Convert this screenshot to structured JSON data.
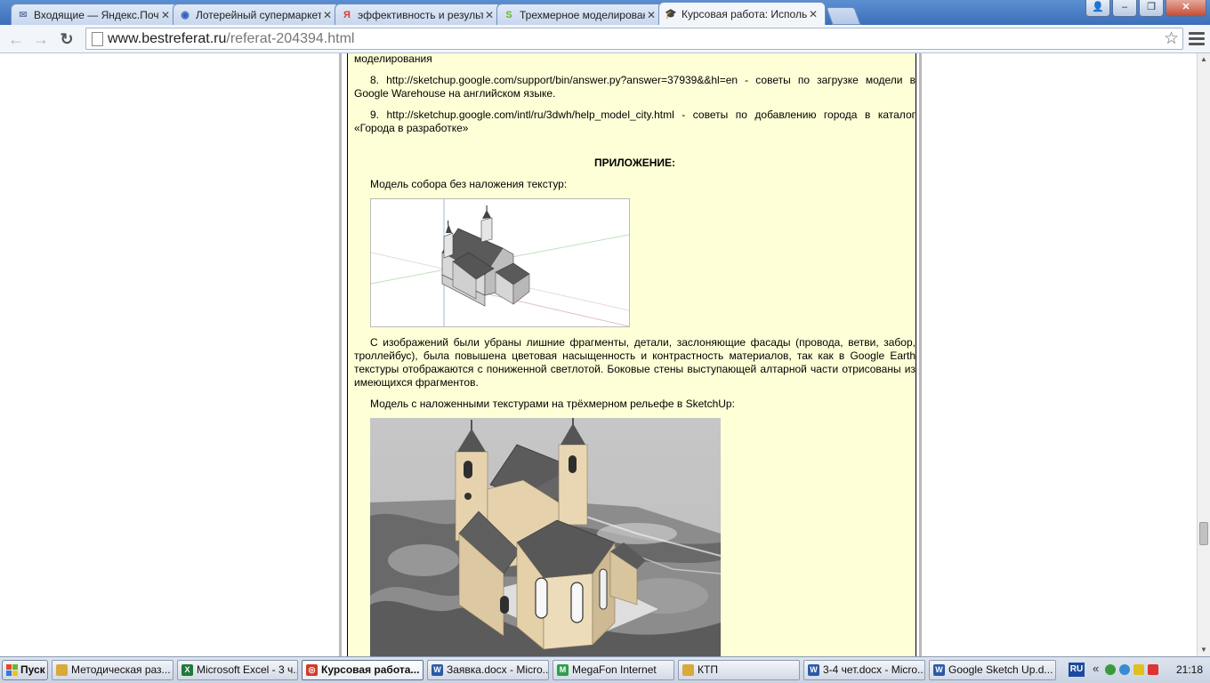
{
  "browser": {
    "tabs": [
      {
        "title": "Входящие — Яндекс.Почта",
        "icon": "mail-icon",
        "color": "#6a7da8",
        "glyph": "✉",
        "active": false
      },
      {
        "title": "Лотерейный супермаркет Столото",
        "icon": "globe-icon",
        "color": "#2e63b8",
        "glyph": "◉",
        "active": false
      },
      {
        "title": "эффективность и результаты",
        "icon": "yandex-icon",
        "color": "#e13a2e",
        "glyph": "Я",
        "active": false
      },
      {
        "title": "Трехмерное моделирование",
        "icon": "site-icon",
        "color": "#6ab52e",
        "glyph": "S",
        "active": false
      },
      {
        "title": "Курсовая работа: Использование",
        "icon": "graduation-cap-icon",
        "color": "#333333",
        "glyph": "🎓",
        "active": true
      }
    ],
    "url_domain": "www.bestreferat.ru",
    "url_path": "/referat-204394.html",
    "window_buttons": {
      "user": "👤",
      "minimize": "–",
      "maximize": "❐",
      "close": "✕"
    },
    "nav": {
      "back": "←",
      "forward": "→",
      "reload": "↻",
      "star": "☆"
    }
  },
  "article": {
    "line_top": "моделирования",
    "ref8": "8. http://sketchup.google.com/support/bin/answer.py?answer=37939&&hl=en - советы по загрузке модели в Google Warehouse на английском языке.",
    "ref9": "9. http://sketchup.google.com/intl/ru/3dwh/help_model_city.html - советы по добавлению города в каталог «Города в разработке»",
    "appendix_heading": "ПРИЛОЖЕНИЕ:",
    "caption1": "Модель собора без наложения текстур:",
    "paragraph": "С изображений были убраны лишние фрагменты, детали, заслоняющие фасады (провода, ветви, забор, троллейбус), была повышена цветовая насыщенность и контрастность материалов, так как в Google Earth текстуры отображаются с пониженной светлотой. Боковые стены выступающей алтарной части отрисованы из имеющихся фрагментов.",
    "caption2": "Модель с наложенными текстурами на трёхмерном рельефе в SketchUp:"
  },
  "scrollbar": {
    "up": "▲",
    "down": "▼"
  },
  "taskbar": {
    "start_label": "Пуск",
    "items": [
      {
        "label": "Методическая раз...",
        "icon": "folder-icon",
        "color": "#d9a93a",
        "glyph": ""
      },
      {
        "label": "Microsoft Excel - 3 ч...",
        "icon": "excel-icon",
        "color": "#1e7a3a",
        "glyph": "X"
      },
      {
        "label": "Курсовая работа...",
        "icon": "chrome-icon",
        "color": "#d13b2b",
        "glyph": "◎",
        "active": true
      },
      {
        "label": "Заявка.docx - Micro...",
        "icon": "word-icon",
        "color": "#2a5aa8",
        "glyph": "W"
      },
      {
        "label": "MegaFon Internet",
        "icon": "megafon-icon",
        "color": "#2e9e4a",
        "glyph": "M"
      },
      {
        "label": "КТП",
        "icon": "folder-icon",
        "color": "#d9a93a",
        "glyph": ""
      },
      {
        "label": "3-4 чет.docx - Micro...",
        "icon": "word-icon",
        "color": "#2a5aa8",
        "glyph": "W"
      },
      {
        "label": "Google Sketch Up.d...",
        "icon": "word-icon",
        "color": "#2a5aa8",
        "glyph": "W"
      }
    ],
    "tray": {
      "language": "RU",
      "chevron": "«",
      "time": "21:18"
    }
  }
}
